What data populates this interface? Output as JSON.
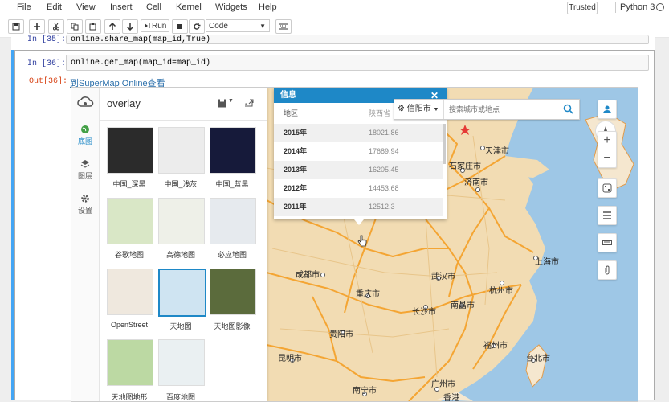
{
  "menubar": {
    "items": [
      "File",
      "Edit",
      "View",
      "Insert",
      "Cell",
      "Kernel",
      "Widgets",
      "Help"
    ],
    "trusted": "Trusted",
    "kernel": "Python 3"
  },
  "toolbar": {
    "run_label": "Run",
    "cell_type": "Code"
  },
  "cells": {
    "prev_prompt": "In [35]:",
    "prev_code": "online.share_map(map_id,True)",
    "in_prompt": "In [36]:",
    "in_code": "online.get_map(map_id=map_id)",
    "out_prompt": "Out[36]:",
    "out_link": "到SuperMap Online查看"
  },
  "map": {
    "title": "overlay",
    "nav": [
      {
        "label": "底图",
        "icon": "globe-icon"
      },
      {
        "label": "图层",
        "icon": "layers-icon"
      },
      {
        "label": "设置",
        "icon": "gear-icon"
      }
    ],
    "basemaps": [
      {
        "label": "中国_深黑",
        "color": "#2b2b2b"
      },
      {
        "label": "中国_浅灰",
        "color": "#ececec"
      },
      {
        "label": "中国_蓝黑",
        "color": "#161a3a"
      },
      {
        "label": "谷歌地图",
        "color": "#d9e7c6"
      },
      {
        "label": "高德地图",
        "color": "#eef0e8"
      },
      {
        "label": "必应地图",
        "color": "#e6eaee"
      },
      {
        "label": "OpenStreet",
        "color": "#efe8de"
      },
      {
        "label": "天地图",
        "color": "#cfe4f2"
      },
      {
        "label": "天地图影像",
        "color": "#5b6b3c"
      },
      {
        "label": "天地图地形",
        "color": "#bcd9a3"
      },
      {
        "label": "百度地图",
        "color": "#eaf0f2"
      }
    ],
    "info": {
      "title": "信息",
      "col1": "地区",
      "col2": "陕西省",
      "rows": [
        {
          "year": "2015年",
          "value": "18021.86"
        },
        {
          "year": "2014年",
          "value": "17689.94"
        },
        {
          "year": "2013年",
          "value": "16205.45"
        },
        {
          "year": "2012年",
          "value": "14453.68"
        },
        {
          "year": "2011年",
          "value": "12512.3"
        }
      ]
    },
    "search": {
      "city": "信阳市",
      "placeholder": "搜索城市或地点"
    },
    "cities": [
      "天津市",
      "石家庄市",
      "济南市",
      "成都市",
      "武汉市",
      "上海市",
      "重庆市",
      "长沙市",
      "杭州市",
      "南昌市",
      "贵阳市",
      "福州市",
      "昆明市",
      "台北市",
      "广州市",
      "南宁市",
      "香港"
    ],
    "colors": {
      "land": "#f2dcb3",
      "province_border": "#f4a533",
      "sea": "#9ec7e6",
      "accent": "#1e88c7"
    }
  }
}
